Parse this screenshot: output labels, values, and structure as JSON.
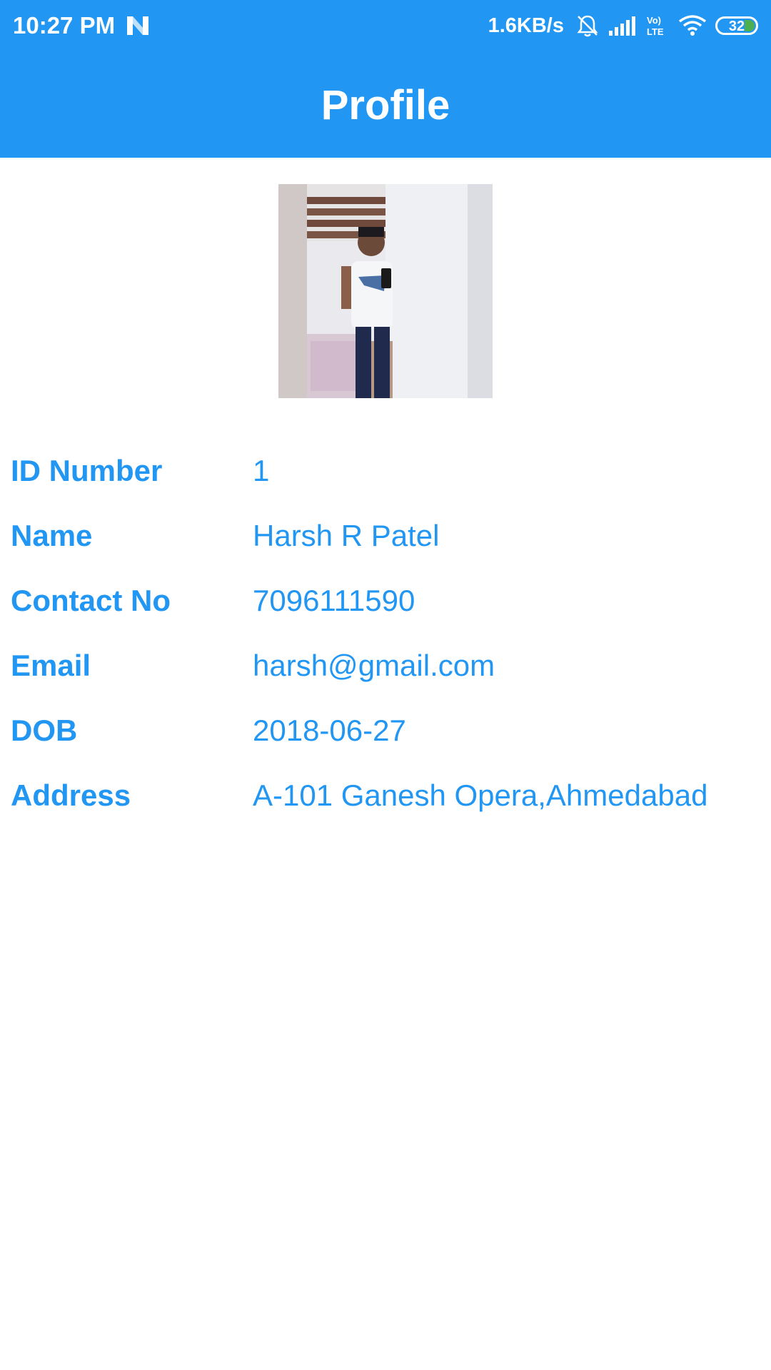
{
  "status_bar": {
    "time": "10:27 PM",
    "net_speed": "1.6KB/s",
    "battery": "32",
    "icons": [
      "notification-n-icon",
      "bell-muted-icon",
      "signal-icon",
      "volte-icon",
      "wifi-icon",
      "battery-icon"
    ]
  },
  "header": {
    "title": "Profile"
  },
  "colors": {
    "accent": "#2196F3",
    "background": "#FFFFFF"
  },
  "profile": {
    "fields": [
      {
        "label": "ID Number",
        "value": "1"
      },
      {
        "label": "Name",
        "value": "Harsh R Patel"
      },
      {
        "label": "Contact No",
        "value": "7096111590"
      },
      {
        "label": "Email",
        "value": "harsh@gmail.com"
      },
      {
        "label": "DOB",
        "value": "2018-06-27"
      },
      {
        "label": "Address",
        "value": "A-101 Ganesh Opera,Ahmedabad"
      }
    ]
  }
}
